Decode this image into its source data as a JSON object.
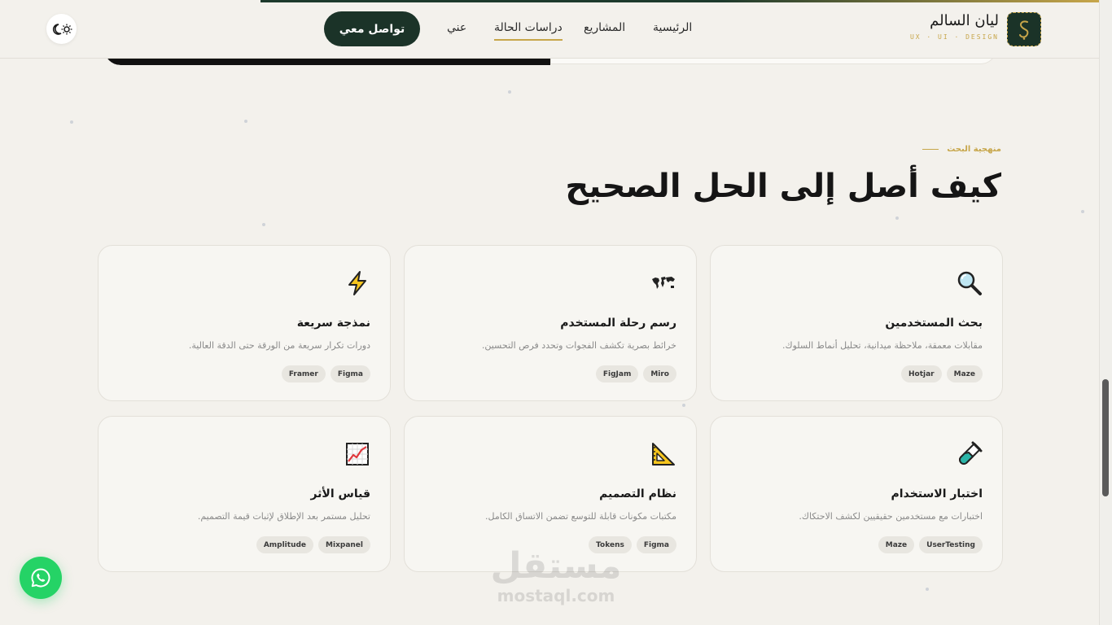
{
  "brand": {
    "name": "ليان السالم",
    "subtitle": "UX · UI · DESIGN",
    "gold": "#c7a64a",
    "green": "#1b3328"
  },
  "nav": {
    "items": [
      {
        "label": "الرئيسية",
        "active": false
      },
      {
        "label": "المشاريع",
        "active": false
      },
      {
        "label": "دراسات الحالة",
        "active": true
      },
      {
        "label": "عني",
        "active": false
      }
    ],
    "contact_label": "تواصل معي",
    "theme_icon": "moon-sun-icon"
  },
  "section": {
    "eyebrow": "منهجية البحث",
    "title": "كيف أصل إلى الحل الصحيح"
  },
  "cards": [
    {
      "icon": "magnifier-icon",
      "title": "بحث المستخدمين",
      "desc": "مقابلات معمقة، ملاحظة ميدانية، تحليل أنماط السلوك.",
      "tags": [
        "Maze",
        "Hotjar"
      ]
    },
    {
      "icon": "world-map-icon",
      "title": "رسم رحلة المستخدم",
      "desc": "خرائط بصرية تكشف الفجوات وتحدد فرص التحسين.",
      "tags": [
        "Miro",
        "FigJam"
      ]
    },
    {
      "icon": "lightning-icon",
      "title": "نمذجة سريعة",
      "desc": "دورات تكرار سريعة من الورقة حتى الدقة العالية.",
      "tags": [
        "Figma",
        "Framer"
      ]
    },
    {
      "icon": "test-tube-icon",
      "title": "اختبار الاستخدام",
      "desc": "اختبارات مع مستخدمين حقيقيين لكشف الاحتكاك.",
      "tags": [
        "UserTesting",
        "Maze"
      ]
    },
    {
      "icon": "triangle-ruler-icon",
      "title": "نظام التصميم",
      "desc": "مكتبات مكونات قابلة للتوسع تضمن الاتساق الكامل.",
      "tags": [
        "Figma",
        "Tokens"
      ]
    },
    {
      "icon": "chart-up-icon",
      "title": "قياس الأثر",
      "desc": "تحليل مستمر بعد الإطلاق لإثبات قيمة التصميم.",
      "tags": [
        "Mixpanel",
        "Amplitude"
      ]
    }
  ],
  "floating": {
    "whatsapp_icon": "whatsapp-icon"
  },
  "watermark": {
    "arabic": "مستقل",
    "latin": "mostaql.com"
  }
}
